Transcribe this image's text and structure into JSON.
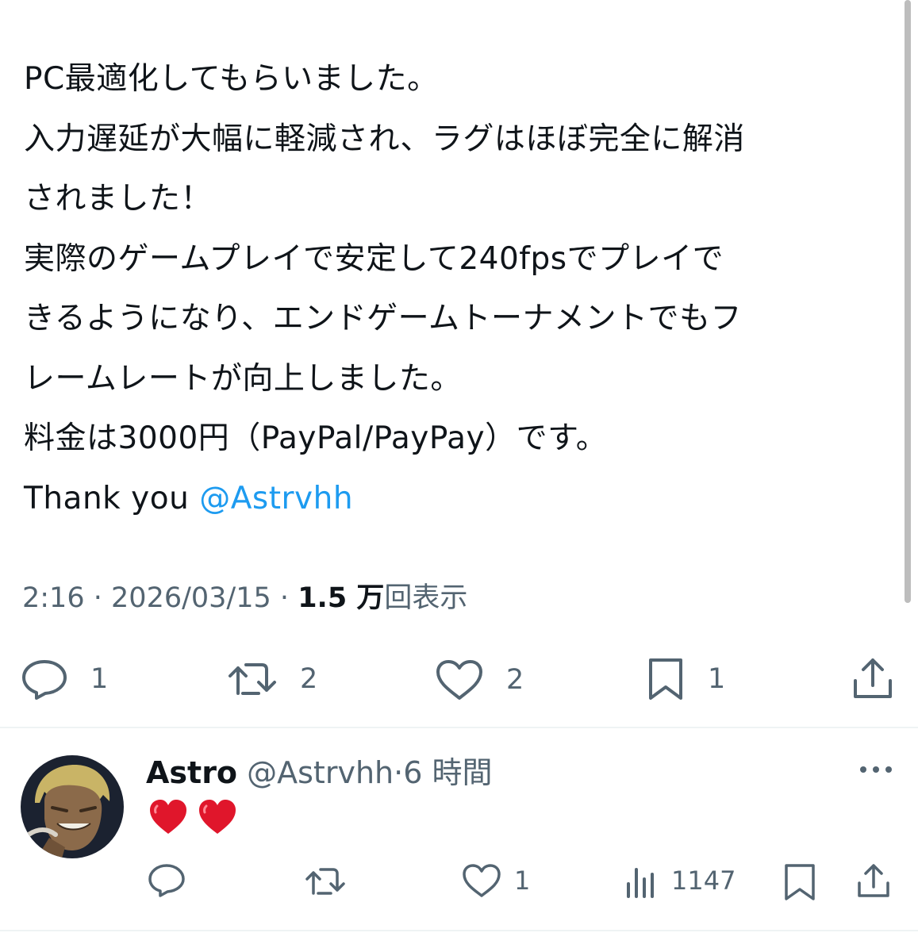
{
  "tweet": {
    "lines": [
      "PC最適化してもらいました。",
      "入力遅延が大幅に軽減され、ラグはほぼ完全に解消",
      "されました！",
      "実際のゲームプレイで安定して240fpsでプレイで",
      "きるようになり、エンドゲームトーナメントでもフ",
      "レームレートが向上しました。",
      "料金は3000円（PayPal/PayPay）です。"
    ],
    "thanks_prefix": "Thank you ",
    "mention": "@Astrvhh",
    "time": "2:16",
    "date": "2026/03/15",
    "views_count": "1.5 万",
    "views_label": "回表示",
    "separator": "·"
  },
  "actions": {
    "reply_count": "1",
    "retweet_count": "2",
    "like_count": "2",
    "bookmark_count": "1"
  },
  "reply": {
    "name": "Astro",
    "handle": "@Astrvhh",
    "separator": "·",
    "time": "6 時間",
    "content_icons": [
      "heart-emoji",
      "heart-emoji"
    ],
    "like_count": "1",
    "view_count": "1147"
  },
  "colors": {
    "text": "#0f1419",
    "secondary": "#536471",
    "link": "#1d9bf0",
    "heart_emoji": "#e0162b",
    "divider": "#eff3f4"
  }
}
